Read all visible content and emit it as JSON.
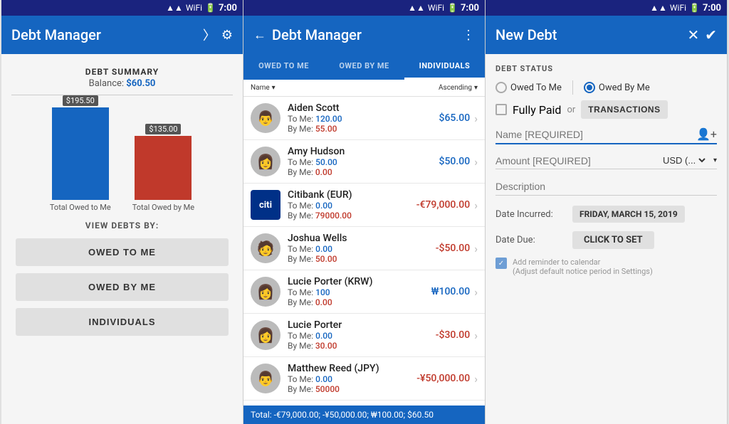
{
  "statusBar": {
    "time": "7:00",
    "icons": [
      "signal",
      "wifi",
      "battery"
    ]
  },
  "panel1": {
    "appTitle": "Debt Manager",
    "debtSummary": {
      "title": "DEBT SUMMARY",
      "balanceLabel": "Balance:",
      "balanceAmount": "$60.50"
    },
    "chart": {
      "bar1": {
        "value": "$195.50",
        "label": "Total Owed to Me",
        "height": 130
      },
      "bar2": {
        "value": "$135.00",
        "label": "Total Owed by Me",
        "height": 90
      }
    },
    "viewDebtsBy": "VIEW DEBTS BY:",
    "buttons": [
      "OWED TO ME",
      "OWED BY ME",
      "INDIVIDUALS"
    ]
  },
  "panel2": {
    "appTitle": "Debt Manager",
    "tabs": [
      {
        "label": "OWED TO ME",
        "active": false
      },
      {
        "label": "OWED BY ME",
        "active": false
      },
      {
        "label": "INDIVIDUALS",
        "active": true
      }
    ],
    "sortField": "Name",
    "sortOrder": "Ascending",
    "individuals": [
      {
        "name": "Aiden Scott",
        "toMe": "120.00",
        "byMe": "55.00",
        "amount": "$65.00",
        "positive": true,
        "avatar": "👨"
      },
      {
        "name": "Amy Hudson",
        "toMe": "50.00",
        "byMe": "0.00",
        "amount": "$50.00",
        "positive": true,
        "avatar": "👩"
      },
      {
        "name": "Citibank (EUR)",
        "toMe": "0.00",
        "byMe": "79000.00",
        "amount": "-€79,000.00",
        "positive": false,
        "avatar": "citi"
      },
      {
        "name": "Joshua Wells",
        "toMe": "0.00",
        "byMe": "50.00",
        "amount": "-$50.00",
        "positive": false,
        "avatar": "👨"
      },
      {
        "name": "Lucie Porter (KRW)",
        "toMe": "100",
        "byMe": "0.00",
        "amount": "₩100.00",
        "positive": true,
        "avatar": "👩"
      },
      {
        "name": "Lucie Porter",
        "toMe": "0.00",
        "byMe": "30.00",
        "amount": "-$30.00",
        "positive": false,
        "avatar": "👩"
      },
      {
        "name": "Matthew Reed (JPY)",
        "toMe": "0.00",
        "byMe": "50000",
        "amount": "-¥50,000.00",
        "positive": false,
        "avatar": "👨"
      }
    ],
    "totalBar": "Total: -€79,000.00; -¥50,000.00; ₩100.00; $60.50"
  },
  "panel3": {
    "appTitle": "New Debt",
    "debtStatus": {
      "sectionLabel": "DEBT STATUS",
      "owedToMe": "Owed To Me",
      "owedByMe": "Owed By Me",
      "owedByMeSelected": true,
      "fullyPaid": "Fully Paid",
      "or": "or",
      "transactionsBtn": "TRANSACTIONS"
    },
    "nameField": {
      "placeholder": "Name [REQUIRED]"
    },
    "amountField": {
      "placeholder": "Amount [REQUIRED]",
      "currency": "USD (..."
    },
    "descriptionField": {
      "placeholder": "Description"
    },
    "dateIncurred": {
      "label": "Date Incurred:",
      "value": "FRIDAY, MARCH 15, 2019"
    },
    "dateDue": {
      "label": "Date Due:",
      "value": "CLICK TO SET"
    },
    "reminder": {
      "text": "Add reminder to calendar",
      "subtext": "(Adjust default notice period in Settings)"
    }
  }
}
